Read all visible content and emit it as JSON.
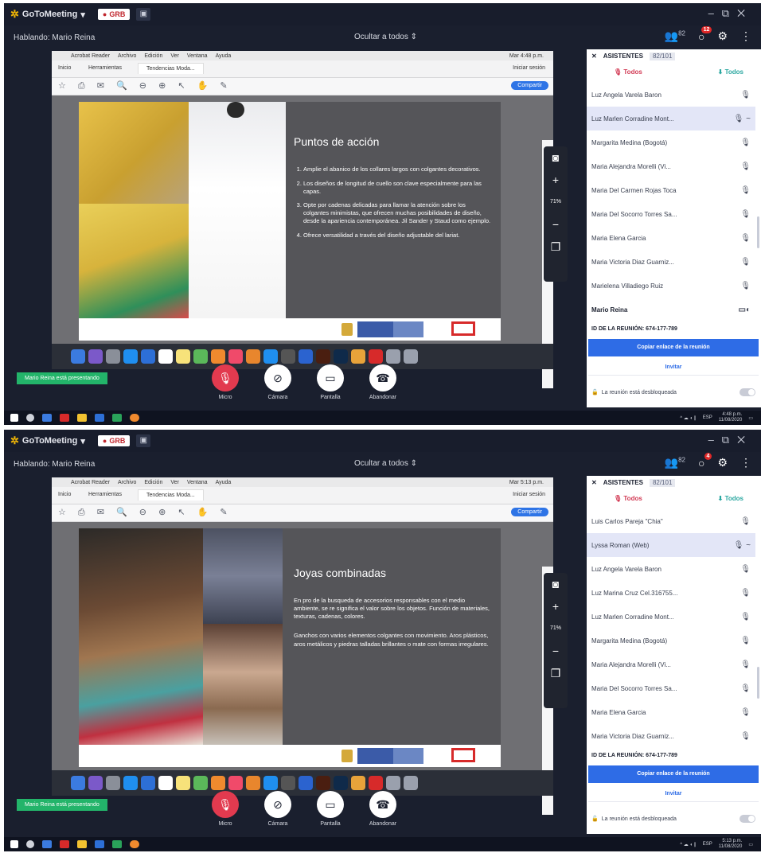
{
  "colors": {
    "accent": "#2e6ce6",
    "mic_red": "#e23a4f",
    "presenting_green": "#23b46a",
    "dark_bg": "#1a1f2e"
  },
  "frames": [
    {
      "app_title": "GoToMeeting",
      "rec_label": "GRB",
      "speaking": "Hablando: Mario Reina",
      "hide_all": "Ocultar a todos",
      "attendee_count": "82",
      "notif_count": "12",
      "mac_menu": [
        "Acrobat Reader",
        "Archivo",
        "Edición",
        "Ver",
        "Ventana",
        "Ayuda"
      ],
      "mac_clock": "Mar 4:48 p.m.",
      "tabs": [
        "Inicio",
        "Herramientas",
        "Tendencias Moda..."
      ],
      "signin": "Iniciar sesión",
      "share_label": "Compartir",
      "slide_title": "Puntos de acción",
      "slide_items": [
        "Amplie el abanico de los collares largos con colgantes decorativos.",
        "Los diseños de longitud de cuello son clave especialmente para las capas.",
        "Opte por cadenas delicadas para llamar la atención sobre los colgantes minimistas, que ofrecen muchas posibilidades de diseño, desde la apariencia contemporánea. Jil Sander y Staud como ejemplo.",
        "Ofrece versatilidad a través del diseño adjustable del lariat."
      ],
      "zoom_pct": "71%",
      "presenting": "Mario Reina está presentando",
      "controls": [
        "Micro",
        "Cámara",
        "Pantalla",
        "Abandonar"
      ],
      "attendees_title": "ASISTENTES",
      "attendees_count_label": "82/101",
      "filter_left": "Todos",
      "filter_right": "Todos",
      "attendees": [
        "Luz Angela Varela Baron",
        "Luz Marlen Corradine Mont...",
        "Margarita Medina (Bogotá)",
        "Maria Alejandra Morelli (Vi...",
        "Maria Del Carmen Rojas Toca",
        "Maria Del Socorro Torres Sa...",
        "Maria Elena Garcia",
        "Maria Victoria Diaz Guarniz...",
        "Marielena Villadiego Ruiz",
        "Mario Reina"
      ],
      "meeting_id": "ID DE LA REUNIÓN: 674-177-789",
      "copy_link": "Copiar enlace de la reunión",
      "invite": "Invitar",
      "unlocked": "La reunión está desbloqueada",
      "task_clock": "4:48 p.m.",
      "task_date": "11/08/2020",
      "task_lang": "ESP"
    },
    {
      "app_title": "GoToMeeting",
      "rec_label": "GRB",
      "speaking": "Hablando: Mario Reina",
      "hide_all": "Ocultar a todos",
      "attendee_count": "82",
      "notif_count": "4",
      "mac_menu": [
        "Acrobat Reader",
        "Archivo",
        "Edición",
        "Ver",
        "Ventana",
        "Ayuda"
      ],
      "mac_clock": "Mar 5:13 p.m.",
      "tabs": [
        "Inicio",
        "Herramientas",
        "Tendencias Moda..."
      ],
      "signin": "Iniciar sesión",
      "share_label": "Compartir",
      "slide_title": "Joyas combinadas",
      "slide_paras": [
        "En pro de la busqueda de accesorios responsables con el medio ambiente, se re significa el valor sobre los objetos. Función de materiales, texturas, cadenas, colores.",
        "Ganchos con varios elementos colgantes con movimiento. Aros plásticos, aros metálicos y piedras talladas brillantes o mate con formas irregulares."
      ],
      "zoom_pct": "71%",
      "presenting": "Mario Reina está presentando",
      "controls": [
        "Micro",
        "Cámara",
        "Pantalla",
        "Abandonar"
      ],
      "attendees_title": "ASISTENTES",
      "attendees_count_label": "82/101",
      "filter_left": "Todos",
      "filter_right": "Todos",
      "attendees": [
        "Luis Carlos Pareja \"Chia\"",
        "Lyssa Roman (Web)",
        "Luz Angela Varela Baron",
        "Luz Marina Cruz Cel.316755...",
        "Luz Marlen Corradine Mont...",
        "Margarita Medina (Bogotá)",
        "Maria Alejandra Morelli (Vi...",
        "Maria Del Socorro Torres Sa...",
        "Maria Elena Garcia",
        "Maria Victoria Diaz Guarniz..."
      ],
      "meeting_id": "ID DE LA REUNIÓN: 674-177-789",
      "copy_link": "Copiar enlace de la reunión",
      "invite": "Invitar",
      "unlocked": "La reunión está desbloqueada",
      "task_clock": "5:13 p.m.",
      "task_date": "11/08/2020",
      "task_lang": "ESP"
    }
  ]
}
